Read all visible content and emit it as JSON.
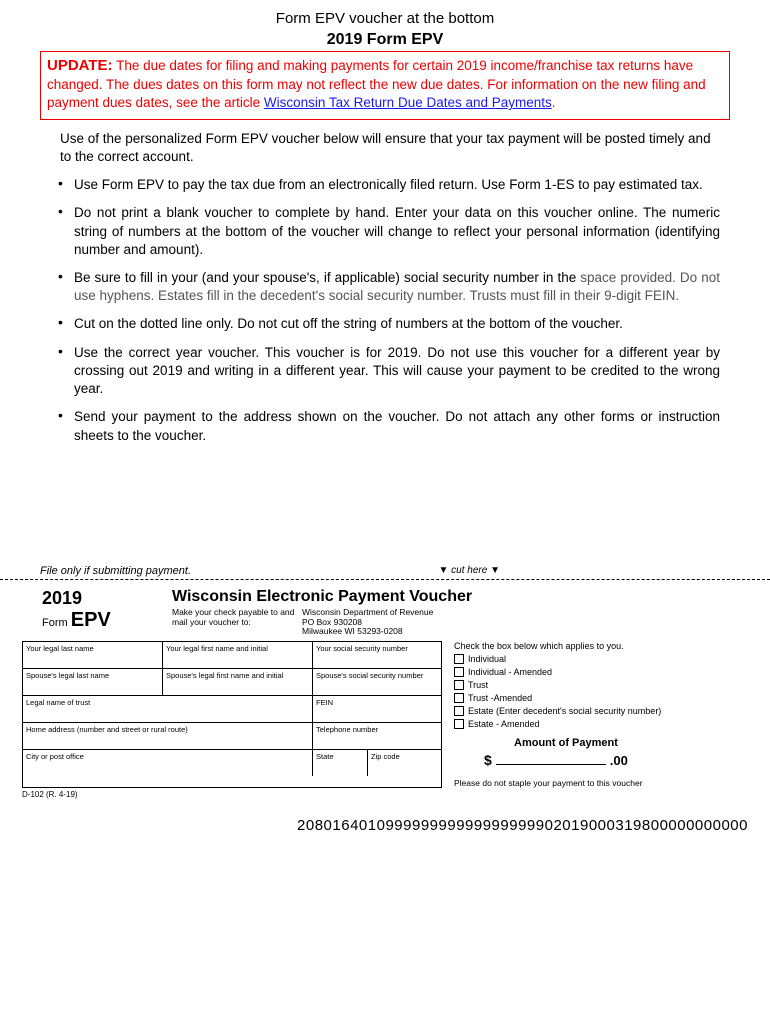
{
  "top_caption": "Form EPV voucher at the bottom",
  "form_title_year": "2019",
  "form_title_rest": " Form EPV",
  "update": {
    "label": "UPDATE:",
    "text": " The due dates for filing and making payments for certain 2019 income/franchise tax returns have changed. The dues dates on this form may not reflect the new due dates. For information on the new filing and payment dues dates, see the article ",
    "link": "Wisconsin Tax Return Due Dates and Payments",
    "period": "."
  },
  "intro": "Use of the personalized Form EPV voucher below will ensure that your tax payment will be posted timely and to the correct account.",
  "bullets": [
    "Use Form EPV to pay the tax due from an electronically filed return. Use Form 1-ES to pay estimated tax.",
    "Do not print a blank voucher to complete by hand. Enter your data on this voucher online.  The numeric string of numbers at the bottom of the voucher will change to reflect your personal information  (identifying number and amount).",
    "Be sure to fill in your (and your spouse's, if applicable) social security number in the space provided. Do not use hyphens. Estates fill in the decedent's social security number. Trusts must fill in their 9-digit FEIN.",
    "Cut on the dotted line only.  Do not cut off the string of numbers at the bottom of the voucher.",
    "Use the correct year voucher. This voucher is for 2019. Do not use this voucher for a different year by crossing out 2019 and writing in a different year.  This will cause your payment to be credited to the wrong year.",
    "Send your payment to the address shown on the voucher. Do not attach any other forms or instruction sheets to the voucher."
  ],
  "bullet2_gray": "space provided. Do not use hyphens. Estates fill in the decedent's social security number. Trusts must fill in their 9-digit FEIN.",
  "bullet2_black": "Be sure to fill in your (and your spouse's, if applicable) social security number in the",
  "file_only": "File only if submitting payment.",
  "cut_here": "cut here",
  "voucher": {
    "year": "2019",
    "form_word": "Form",
    "epv": "EPV",
    "title": "Wisconsin Electronic Payment Voucher",
    "payable_label": "Make your check payable to and mail your voucher to:",
    "addr1": "Wisconsin Department of Revenue",
    "addr2": "PO Box 930208",
    "addr3": "Milwaukee WI  53293-0208",
    "fields": {
      "last": "Your legal last name",
      "first": "Your legal first name and initial",
      "ssn": "Your social security number",
      "sp_last": "Spouse's legal last name",
      "sp_first": "Spouse's legal first name and initial",
      "sp_ssn": "Spouse's social security number",
      "trust": "Legal name of trust",
      "fein": "FEIN",
      "addr": "Home address (number and street or rural route)",
      "tel": "Telephone number",
      "city": "City or post office",
      "state": "State",
      "zip": "Zip code"
    },
    "check_title": "Check the box below which applies to you.",
    "checks": [
      "Individual",
      "Individual - Amended",
      "Trust",
      "Trust -Amended",
      "Estate (Enter decedent's social security number)",
      "Estate - Amended"
    ],
    "amount_title": "Amount of Payment",
    "dollar": "$",
    "cents": ".00",
    "no_staple": "Please do not staple your payment to this voucher",
    "form_code": "D-102 (R. 4-19)"
  },
  "ocr": "208016401099999999999999999902019000319800000000000"
}
